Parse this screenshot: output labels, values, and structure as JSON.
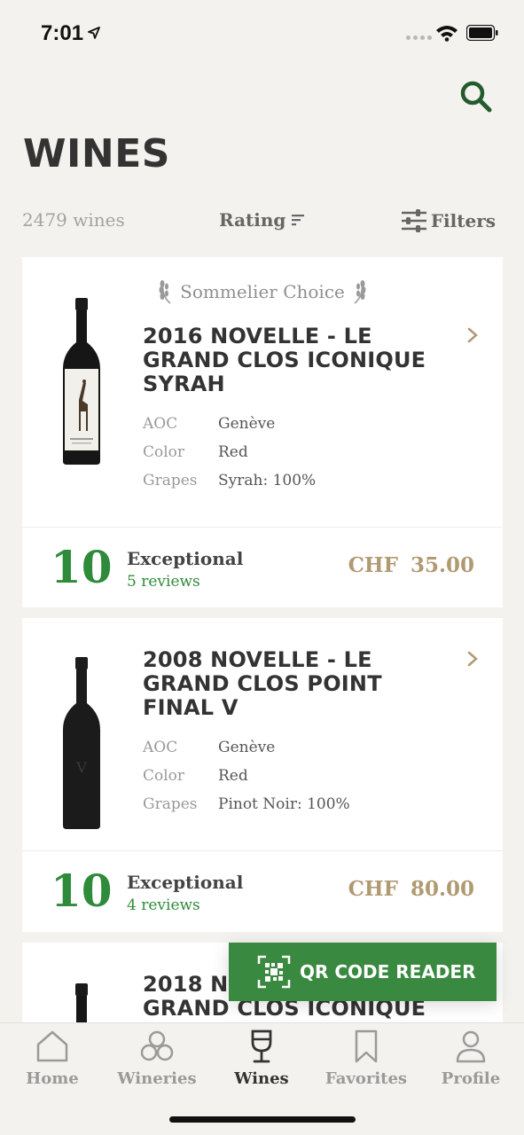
{
  "status_bar": {
    "time": "7:01",
    "icons": [
      "location-arrow-icon",
      "signal-dots-icon",
      "wifi-icon",
      "battery-icon"
    ]
  },
  "header": {
    "title": "WINES",
    "search_icon": "search-icon"
  },
  "list_bar": {
    "count": "2479 wines",
    "sort_label": "Rating",
    "filters_label": "Filters"
  },
  "wines": [
    {
      "badge": "Sommelier Choice",
      "name": "2016 NOVELLE - LE GRAND CLOS ICONIQUE SYRAH",
      "attributes": [
        {
          "key": "AOC",
          "value": "Genève"
        },
        {
          "key": "Color",
          "value": "Red"
        },
        {
          "key": "Grapes",
          "value": "Syrah: 100%"
        }
      ],
      "score": "10",
      "rating_label": "Exceptional",
      "reviews": "5 reviews",
      "currency": "CHF",
      "price": "35.00"
    },
    {
      "name": "2008 NOVELLE - LE GRAND CLOS POINT FINAL V",
      "attributes": [
        {
          "key": "AOC",
          "value": "Genève"
        },
        {
          "key": "Color",
          "value": "Red"
        },
        {
          "key": "Grapes",
          "value": "Pinot Noir: 100%"
        }
      ],
      "score": "10",
      "rating_label": "Exceptional",
      "reviews": "4 reviews",
      "currency": "CHF",
      "price": "80.00"
    },
    {
      "name": "2018 NOVELLE - LE GRAND CLOS ICONIQUE"
    }
  ],
  "qr_button": {
    "label": "QR CODE READER"
  },
  "tab_bar": {
    "tabs": [
      {
        "label": "Home",
        "icon": "home-icon"
      },
      {
        "label": "Wineries",
        "icon": "wineries-icon"
      },
      {
        "label": "Wines",
        "icon": "wine-glass-icon",
        "active": true
      },
      {
        "label": "Favorites",
        "icon": "bookmark-icon"
      },
      {
        "label": "Profile",
        "icon": "profile-icon"
      }
    ]
  },
  "colors": {
    "background": "#f4f2ee",
    "accent_green": "#2e8b3a",
    "qr_green": "#3a8940",
    "price_gold": "#b09a72",
    "card": "#ffffff"
  }
}
